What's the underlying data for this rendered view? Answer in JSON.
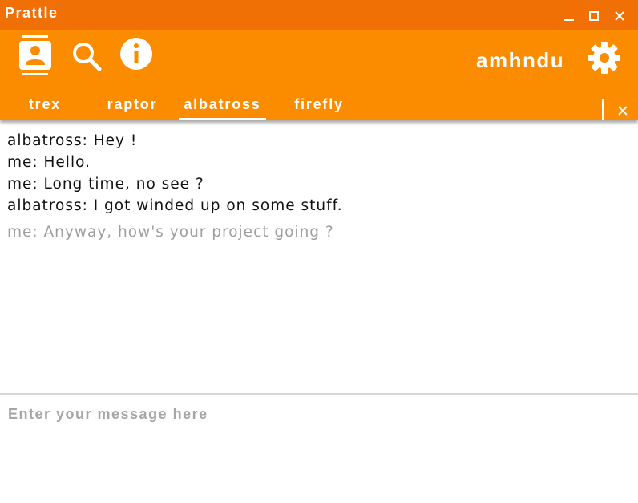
{
  "window": {
    "title": "Prattle",
    "controls": [
      "minimize-icon",
      "maximize-icon",
      "close-icon"
    ]
  },
  "toolbar": {
    "icons": [
      "contacts-icon",
      "search-icon",
      "info-icon",
      "gear-icon"
    ],
    "username": "amhndu"
  },
  "tabs": [
    {
      "label": "trex",
      "active": false
    },
    {
      "label": "raptor",
      "active": false
    },
    {
      "label": "albatross",
      "active": true
    },
    {
      "label": "firefly",
      "active": false
    }
  ],
  "tab_bar": {
    "close_icon": "close-icon"
  },
  "messages": [
    {
      "text": "albatross: Hey !",
      "pending": false
    },
    {
      "text": "me: Hello.",
      "pending": false
    },
    {
      "text": "me: Long time, no see ?",
      "pending": false
    },
    {
      "text": "albatross: I got winded up on some stuff.",
      "pending": false
    },
    {
      "text": "me: Anyway, how's your project going ?",
      "pending": true
    }
  ],
  "composer": {
    "placeholder": "Enter your message here",
    "value": ""
  },
  "colors": {
    "titlebar": "#f07006",
    "toolbar": "#fb8c00",
    "pending_text": "#9e9e9e",
    "placeholder_text": "#a6a6a6"
  }
}
